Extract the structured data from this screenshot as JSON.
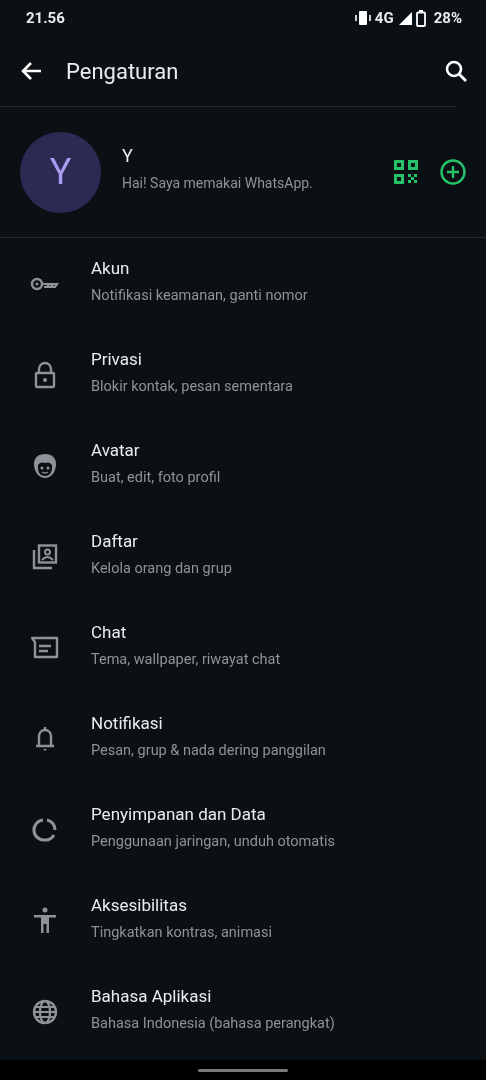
{
  "status_bar": {
    "time": "21.56",
    "network": "4G",
    "battery": "28%"
  },
  "app_bar": {
    "title": "Pengaturan"
  },
  "profile": {
    "initial": "Y",
    "name": "Y",
    "about": "Hai! Saya memakai WhatsApp."
  },
  "items": [
    {
      "title": "Akun",
      "subtitle": "Notifikasi keamanan, ganti nomor"
    },
    {
      "title": "Privasi",
      "subtitle": "Blokir kontak, pesan sementara"
    },
    {
      "title": "Avatar",
      "subtitle": "Buat, edit, foto profil"
    },
    {
      "title": "Daftar",
      "subtitle": "Kelola orang dan grup"
    },
    {
      "title": "Chat",
      "subtitle": "Tema, wallpaper, riwayat chat"
    },
    {
      "title": "Notifikasi",
      "subtitle": "Pesan, grup & nada dering panggilan"
    },
    {
      "title": "Penyimpanan dan Data",
      "subtitle": "Penggunaan jaringan, unduh otomatis"
    },
    {
      "title": "Aksesibilitas",
      "subtitle": "Tingkatkan kontras, animasi"
    },
    {
      "title": "Bahasa Aplikasi",
      "subtitle": "Bahasa Indonesia (bahasa perangkat)"
    }
  ]
}
